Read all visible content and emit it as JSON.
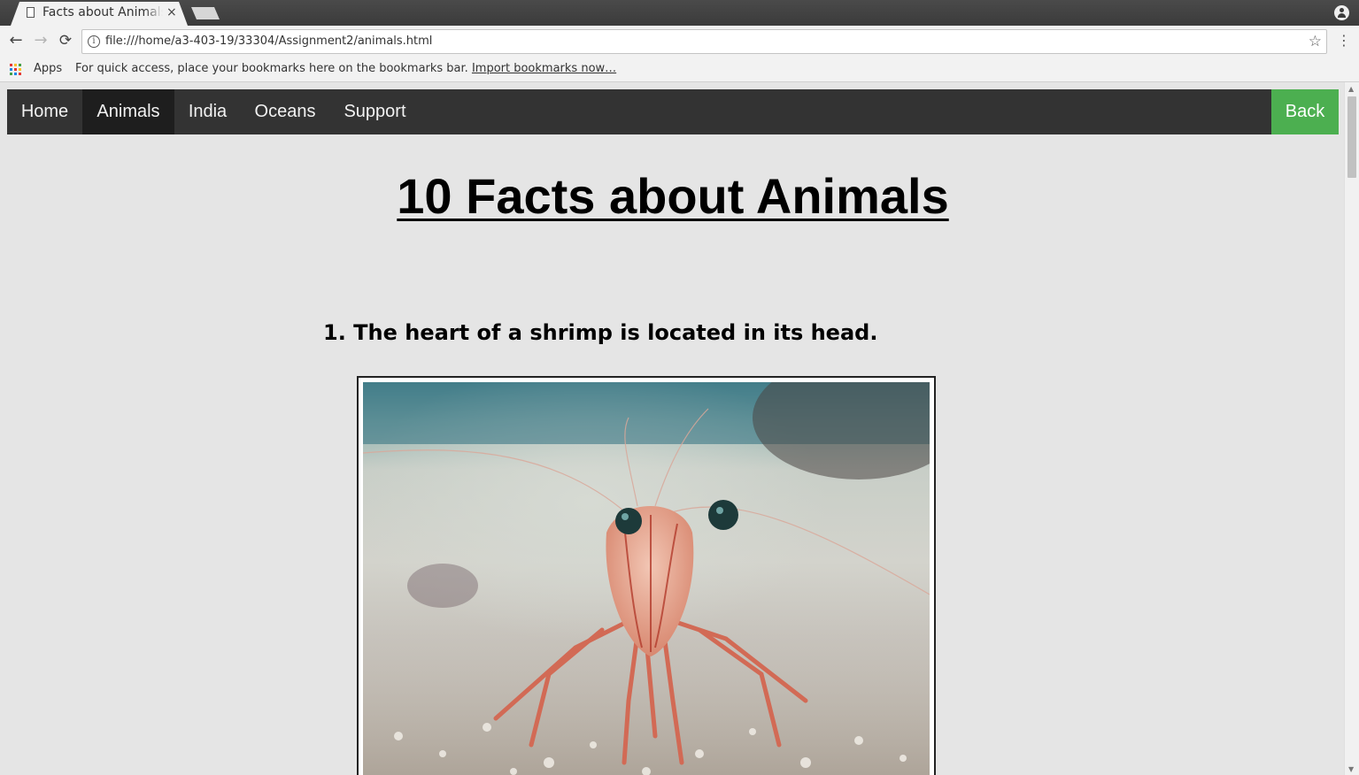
{
  "browser": {
    "tab_title": "Facts about Animals",
    "tab_close": "×",
    "url": "file:///home/a3-403-19/33304/Assignment2/animals.html",
    "bookmarks_apps": "Apps",
    "bookmarks_hint": "For quick access, place your bookmarks here on the bookmarks bar.",
    "bookmarks_import": "Import bookmarks now…"
  },
  "nav": {
    "items": [
      {
        "label": "Home",
        "active": false
      },
      {
        "label": "Animals",
        "active": true
      },
      {
        "label": "India",
        "active": false
      },
      {
        "label": "Oceans",
        "active": false
      },
      {
        "label": "Support",
        "active": false
      }
    ],
    "back_label": "Back",
    "back_color": "#4caf50"
  },
  "page": {
    "title": "10 Facts about Animals",
    "facts": [
      {
        "heading": "1. The heart of a shrimp is located in its head.",
        "image": "shrimp-photo"
      }
    ]
  }
}
